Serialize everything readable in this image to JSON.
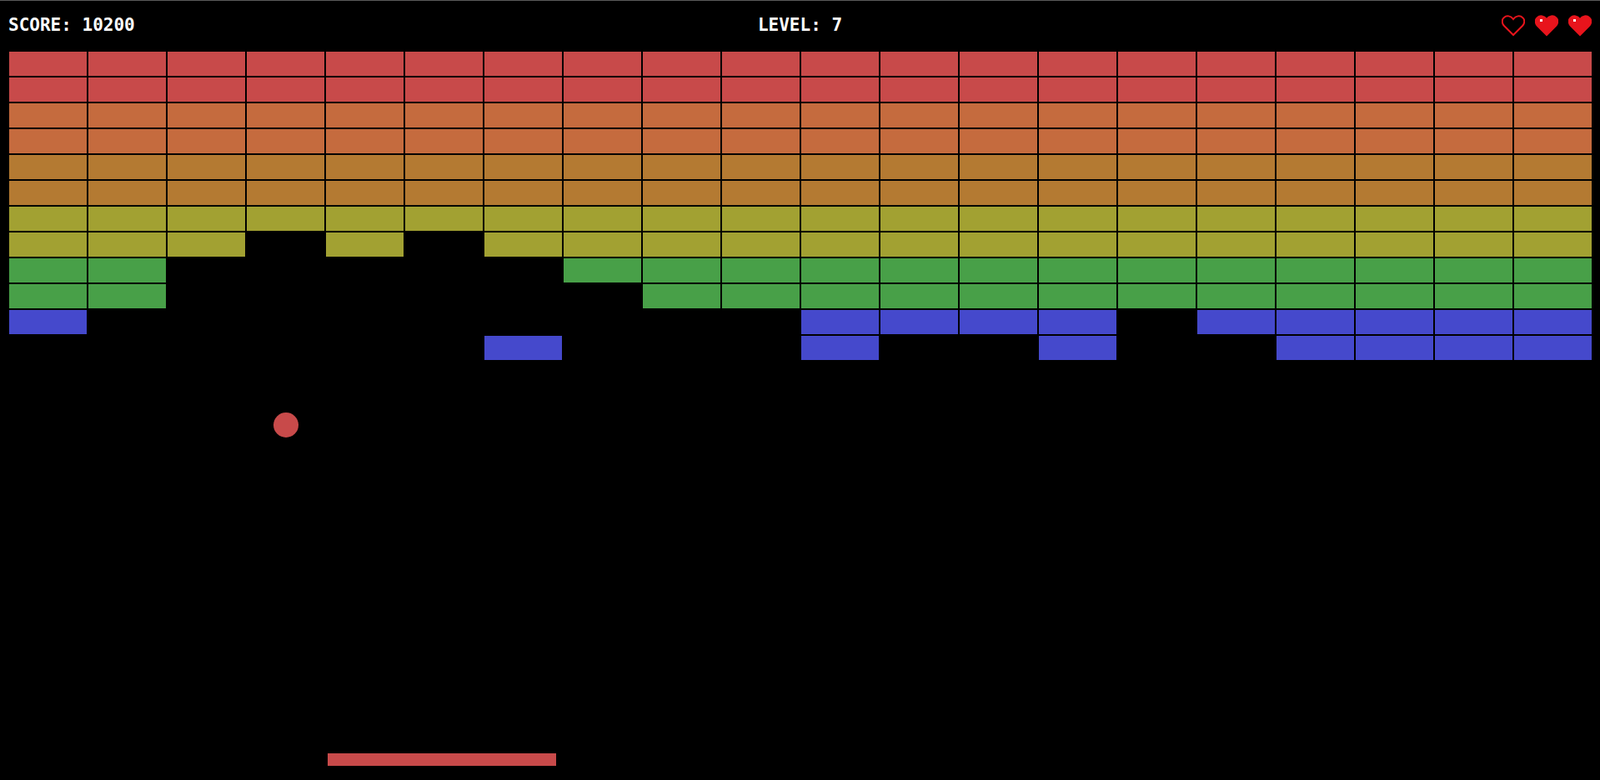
{
  "hud": {
    "score": "SCORE: 10200",
    "level": "LEVEL: 7"
  },
  "lives": [
    {
      "filled": false
    },
    {
      "filled": true
    },
    {
      "filled": true
    }
  ],
  "bricks": {
    "rows": [
      {
        "color": "#c84a4a",
        "present": [
          true,
          true,
          true,
          true,
          true,
          true,
          true,
          true,
          true,
          true,
          true,
          true,
          true,
          true,
          true,
          true,
          true,
          true,
          true,
          true
        ]
      },
      {
        "color": "#c84a4a",
        "present": [
          true,
          true,
          true,
          true,
          true,
          true,
          true,
          true,
          true,
          true,
          true,
          true,
          true,
          true,
          true,
          true,
          true,
          true,
          true,
          true
        ]
      },
      {
        "color": "#c56b3e",
        "present": [
          true,
          true,
          true,
          true,
          true,
          true,
          true,
          true,
          true,
          true,
          true,
          true,
          true,
          true,
          true,
          true,
          true,
          true,
          true,
          true
        ]
      },
      {
        "color": "#c56b3e",
        "present": [
          true,
          true,
          true,
          true,
          true,
          true,
          true,
          true,
          true,
          true,
          true,
          true,
          true,
          true,
          true,
          true,
          true,
          true,
          true,
          true
        ]
      },
      {
        "color": "#b47a32",
        "present": [
          true,
          true,
          true,
          true,
          true,
          true,
          true,
          true,
          true,
          true,
          true,
          true,
          true,
          true,
          true,
          true,
          true,
          true,
          true,
          true
        ]
      },
      {
        "color": "#b47a32",
        "present": [
          true,
          true,
          true,
          true,
          true,
          true,
          true,
          true,
          true,
          true,
          true,
          true,
          true,
          true,
          true,
          true,
          true,
          true,
          true,
          true
        ]
      },
      {
        "color": "#a2a132",
        "present": [
          true,
          true,
          true,
          true,
          true,
          true,
          true,
          true,
          true,
          true,
          true,
          true,
          true,
          true,
          true,
          true,
          true,
          true,
          true,
          true
        ]
      },
      {
        "color": "#a2a132",
        "present": [
          true,
          true,
          true,
          false,
          true,
          false,
          true,
          true,
          true,
          true,
          true,
          true,
          true,
          true,
          true,
          true,
          true,
          true,
          true,
          true
        ]
      },
      {
        "color": "#48a048",
        "present": [
          true,
          true,
          false,
          false,
          false,
          false,
          false,
          true,
          true,
          true,
          true,
          true,
          true,
          true,
          true,
          true,
          true,
          true,
          true,
          true
        ]
      },
      {
        "color": "#48a048",
        "present": [
          true,
          true,
          false,
          false,
          false,
          false,
          false,
          false,
          true,
          true,
          true,
          true,
          true,
          true,
          true,
          true,
          true,
          true,
          true,
          true
        ]
      },
      {
        "color": "#4549cc",
        "present": [
          true,
          false,
          false,
          false,
          false,
          false,
          false,
          false,
          false,
          false,
          true,
          true,
          true,
          true,
          false,
          true,
          true,
          true,
          true,
          true
        ]
      },
      {
        "color": "#4549cc",
        "present": [
          false,
          false,
          false,
          false,
          false,
          false,
          true,
          false,
          false,
          false,
          true,
          false,
          false,
          true,
          false,
          false,
          true,
          true,
          true,
          true
        ]
      }
    ]
  }
}
